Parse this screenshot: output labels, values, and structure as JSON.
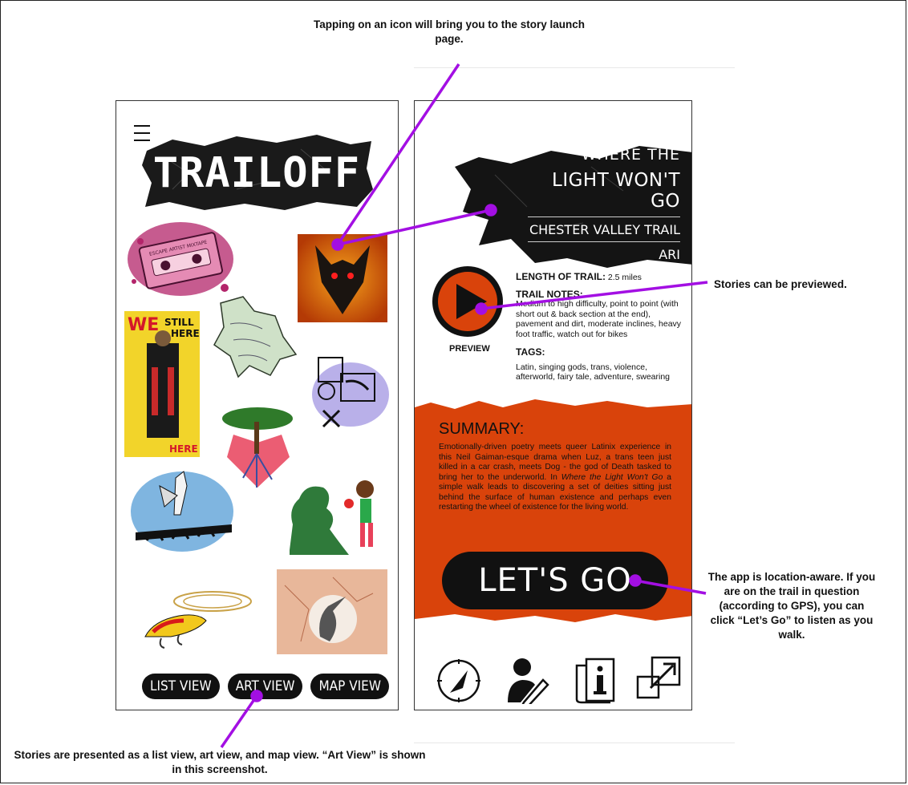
{
  "annotations": {
    "top": "Tapping on an icon will bring you to the story launch page.",
    "preview": "Stories can be previewed.",
    "location": "The app is location-aware. If you are on the trail in question (according to GPS), you can click “Let’s Go” to listen as you walk.",
    "views": "Stories are presented as a list view, art view, and map view. “Art View” is shown in this screenshot."
  },
  "left_screen": {
    "brand": "TRAILOFF",
    "views": [
      "LIST VIEW",
      "ART VIEW",
      "MAP VIEW"
    ],
    "art_tiles": [
      {
        "name": "cassette-art",
        "label": "ESCAPE ARTIST MIXTAPE"
      },
      {
        "name": "dog-art"
      },
      {
        "name": "map-art"
      },
      {
        "name": "we-are-still-here-art",
        "label": "WE ARE STILL HERE"
      },
      {
        "name": "symbols-art"
      },
      {
        "name": "tree-heart-art"
      },
      {
        "name": "bird-bridge-art"
      },
      {
        "name": "boxer-art"
      },
      {
        "name": "fishing-lure-art"
      },
      {
        "name": "heron-art"
      }
    ]
  },
  "right_screen": {
    "title_line1": "WHERE THE",
    "title_line2": "LIGHT WON'T GO",
    "trail": "CHESTER VALLEY TRAIL",
    "author": "ARI",
    "length_label": "LENGTH OF TRAIL:",
    "length_value": "2.5 miles",
    "notes_label": "TRAIL NOTES:",
    "notes_text": "Medium to high difficulty, point to point (with short out & back section at the end), pavement and dirt, moderate inclines, heavy foot traffic, watch out for bikes",
    "tags_label": "TAGS:",
    "tags_text": "Latin, singing gods, trans, violence, afterworld, fairy tale, adventure, swearing",
    "preview_label": "PREVIEW",
    "summary_label": "SUMMARY:",
    "summary_part1": "Emotionally-driven poetry meets queer Latinix experience in this Neil Gaiman-esque drama when Luz, a trans teen just killed in a car crash, meets Dog - the god of Death tasked to bring her to the underworld. In ",
    "summary_italic": "Where the Light Won't Go",
    "summary_part2": " a simple walk leads to discovering a set of deities sitting just behind the surface of human existence and perhaps even restarting the wheel of existence for the living world.",
    "go_label": "LET'S GO",
    "bottom_icons": [
      "compass-icon",
      "author-icon",
      "info-icon",
      "expand-icon"
    ]
  },
  "colors": {
    "accent_line": "#a30fe3",
    "orange": "#d9430b",
    "ink": "#111111"
  }
}
